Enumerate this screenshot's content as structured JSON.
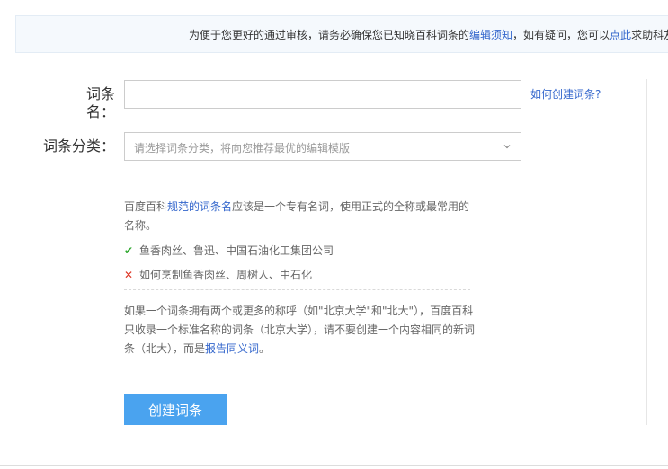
{
  "notice": {
    "prefix": "为便于您更好的通过审核，请务必确保您已知晓百科词条的",
    "link1": "编辑须知",
    "middle": "，如有疑问，您可以",
    "link2": "点此",
    "suffix": "求助科友"
  },
  "form": {
    "name_label": "词条名：",
    "name_value": "",
    "help_link": "如何创建词条?",
    "category_label": "词条分类：",
    "category_placeholder": "请选择词条分类，将向您推荐最优的编辑模版"
  },
  "tips": {
    "p1_prefix": "百度百科",
    "p1_link": "规范的词条名",
    "p1_suffix": "应该是一个专有名词，使用正式的全称或最常用的名称。",
    "good_example": "鱼香肉丝、鲁迅、中国石油化工集团公司",
    "bad_example": "如何烹制鱼香肉丝、周树人、中石化",
    "p2_text": "如果一个词条拥有两个或更多的称呼（如\"北京大学\"和\"北大\"），百度百科只收录一个标准名称的词条（北京大学），请不要创建一个内容相同的新词条（北大），而是",
    "p2_link": "报告同义词",
    "p2_end": "。"
  },
  "create_button": "创建词条",
  "icons": {
    "good": "check-icon",
    "bad": "cross-icon",
    "select": "chevron-down-icon"
  },
  "colors": {
    "link": "#3366cc",
    "button": "#4aa3ef",
    "good": "#33aa33",
    "bad": "#dd3322"
  }
}
